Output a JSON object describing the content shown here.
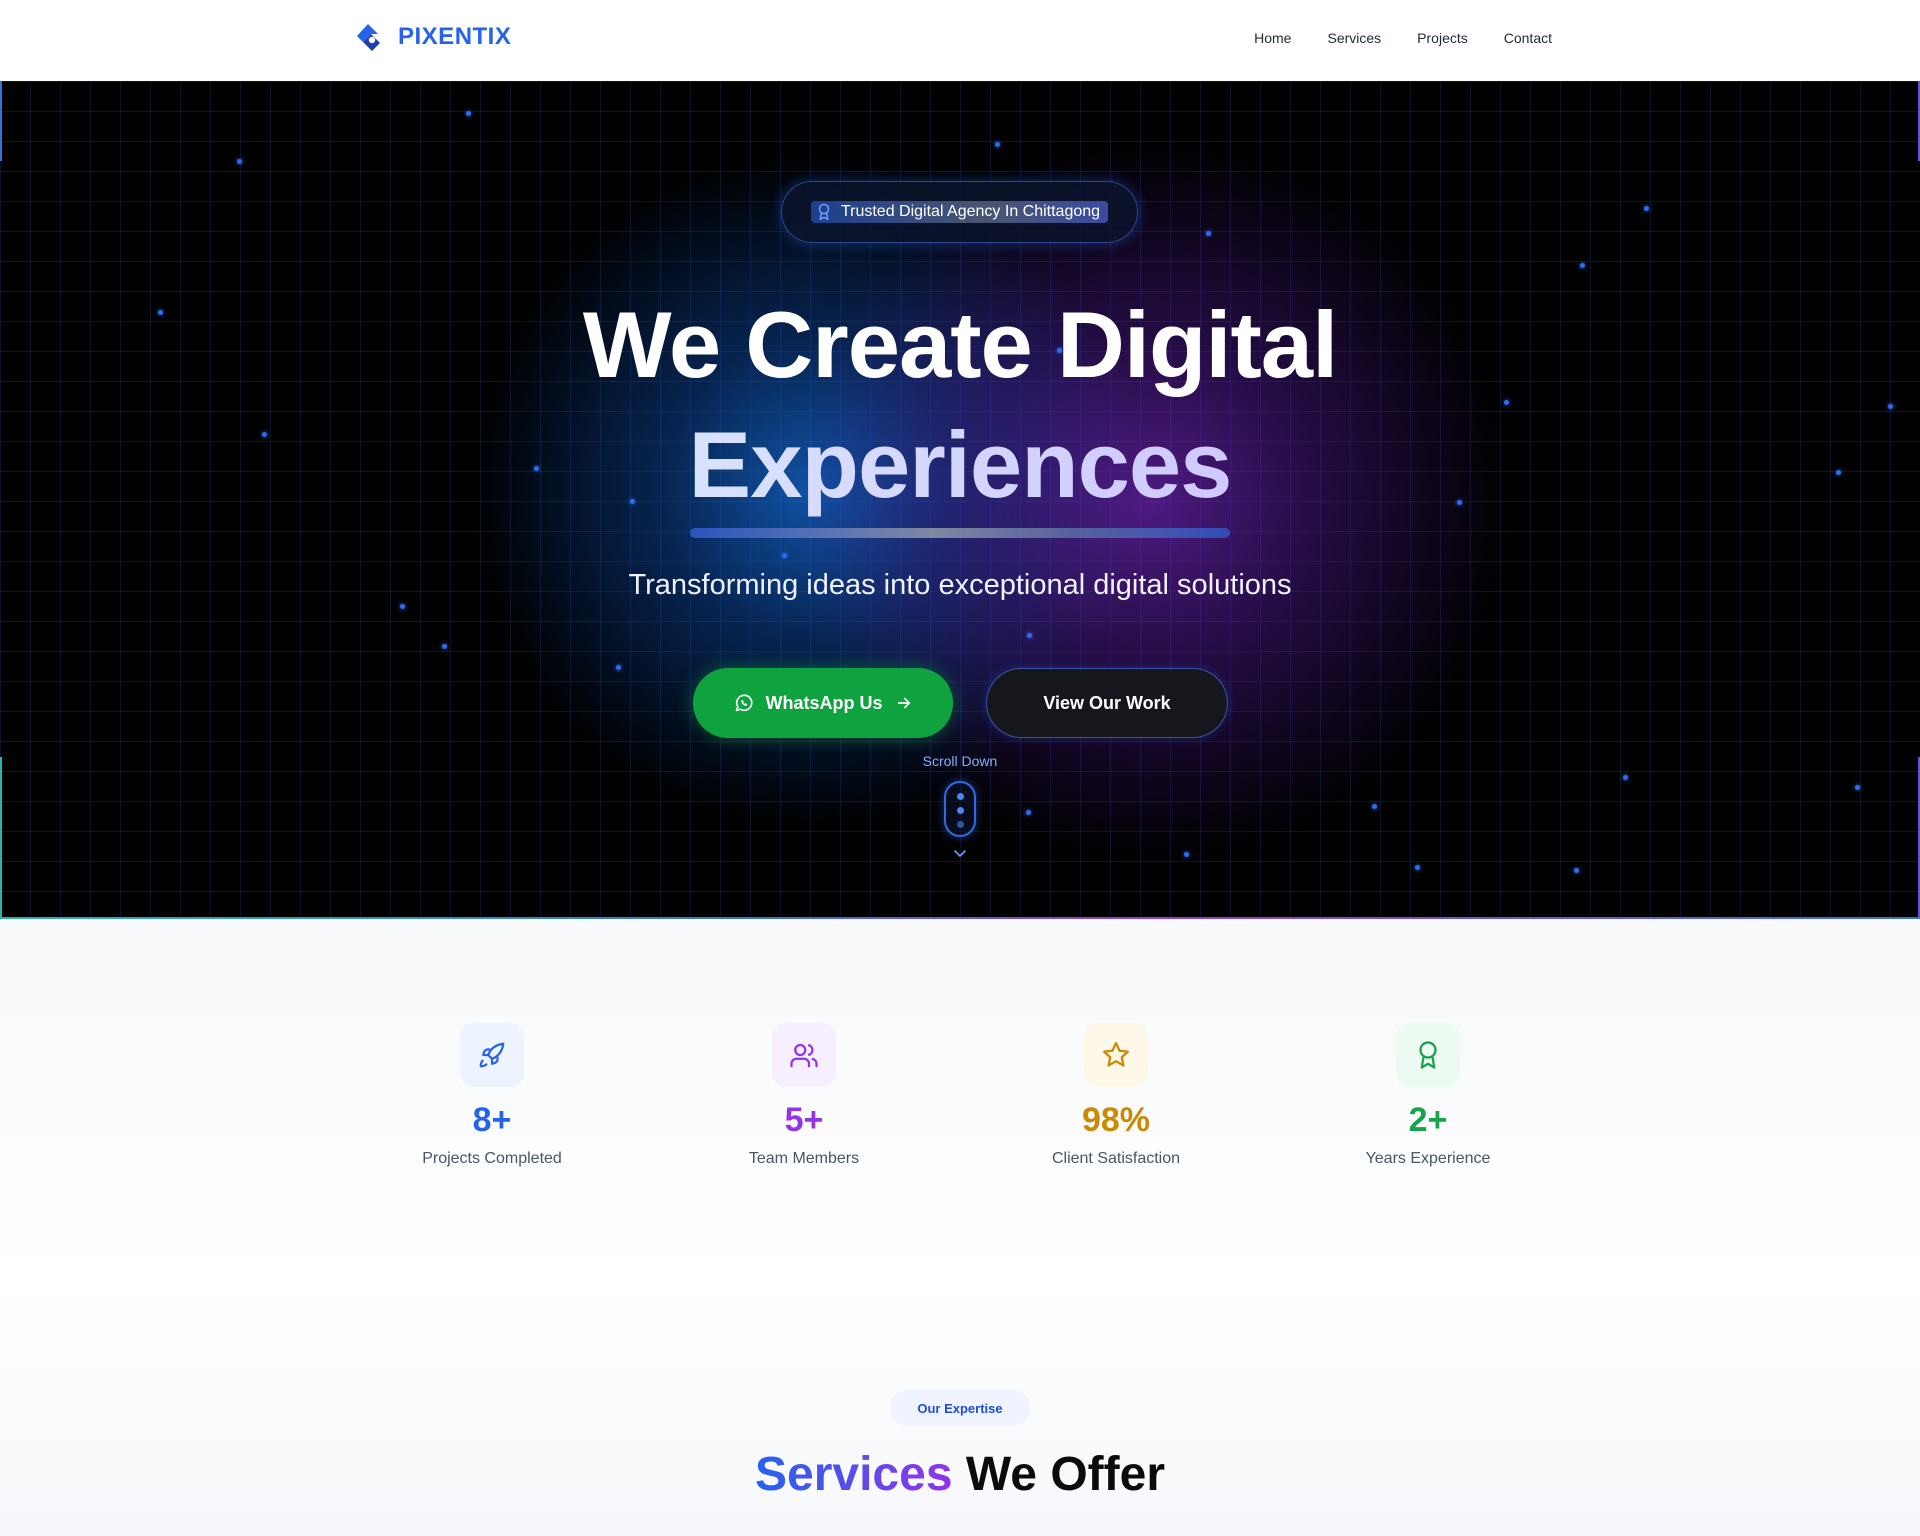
{
  "header": {
    "brand": "PIXENTIX",
    "nav": [
      "Home",
      "Services",
      "Projects",
      "Contact"
    ]
  },
  "hero": {
    "badge": "Trusted Digital Agency In Chittagong",
    "title_line1": "We Create Digital",
    "title_line2": "Experiences",
    "subtitle": "Transforming ideas into exceptional digital solutions",
    "cta_primary": "WhatsApp Us",
    "cta_secondary": "View Our Work",
    "scroll_label": "Scroll Down"
  },
  "stats": [
    {
      "value": "8+",
      "label": "Projects Completed",
      "color": "#2563eb",
      "icon": "rocket-icon"
    },
    {
      "value": "5+",
      "label": "Team Members",
      "color": "#9333ea",
      "icon": "users-icon"
    },
    {
      "value": "98%",
      "label": "Client Satisfaction",
      "color": "#ca8a04",
      "icon": "star-icon"
    },
    {
      "value": "2+",
      "label": "Years Experience",
      "color": "#16a34a",
      "icon": "award-icon"
    }
  ],
  "services": {
    "eyebrow": "Our Expertise",
    "title_highlight": "Services",
    "title_rest": " We Offer"
  },
  "colors": {
    "brand": "#2563eb",
    "whatsapp_green": "#0fa33f",
    "hero_bg": "#000000"
  }
}
